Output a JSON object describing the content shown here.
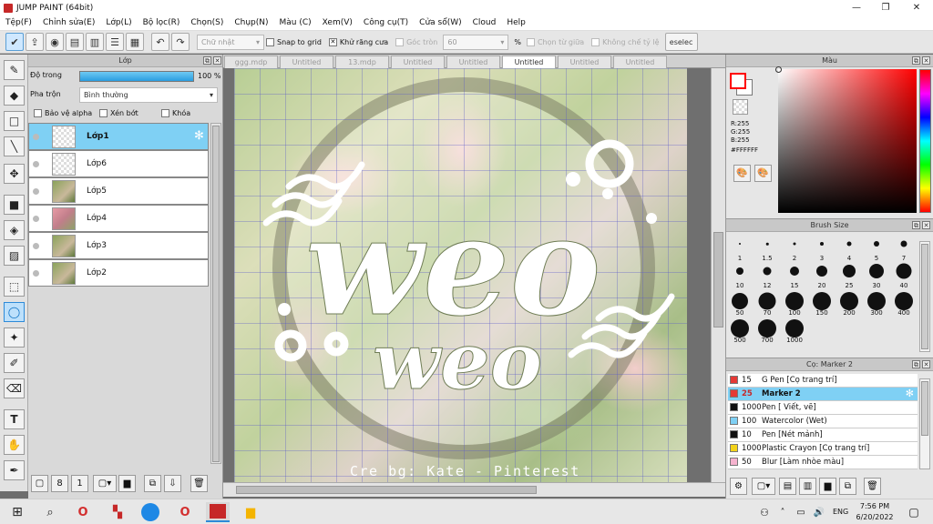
{
  "window": {
    "title": "JUMP PAINT (64bit)",
    "min": "—",
    "max": "❐",
    "close": "✕"
  },
  "menu": [
    "Tệp(F)",
    "Chỉnh sửa(E)",
    "Lớp(L)",
    "Bộ lọc(R)",
    "Chọn(S)",
    "Chụp(N)",
    "Màu (C)",
    "Xem(V)",
    "Công cụ(T)",
    "Cửa sổ(W)",
    "Cloud",
    "Help"
  ],
  "toolbar": {
    "shape_select": "Chữ nhật",
    "snap": "Snap to grid",
    "antialias": "Khử răng cưa",
    "corner": "Góc tròn",
    "corner_value": "60",
    "percent": "%",
    "from_center": "Chọn từ giữa",
    "no_ratio": "Không chế tỷ lệ",
    "deselect": "eselec"
  },
  "layer_panel": {
    "title": "Lớp",
    "opacity_label": "Độ trong",
    "opacity_value": "100 %",
    "opacity": 1.0,
    "blend_label": "Pha trộn",
    "blend_value": "Bình thường",
    "protect_alpha": "Bảo vệ alpha",
    "clip": "Xén bớt",
    "lock": "Khóa",
    "layers": [
      {
        "name": "Lớp1",
        "selected": true
      },
      {
        "name": "Lớp6",
        "selected": false
      },
      {
        "name": "Lớp5",
        "selected": false
      },
      {
        "name": "Lớp4",
        "selected": false
      },
      {
        "name": "Lớp3",
        "selected": false
      },
      {
        "name": "Lớp2",
        "selected": false
      }
    ]
  },
  "tabs": [
    "ggg.mdp",
    "Untitled",
    "13.mdp",
    "Untitled",
    "Untitled",
    "Untitled",
    "Untitled",
    "Untitled"
  ],
  "active_tab": 5,
  "artwork": {
    "line1": "weo",
    "line2": "weo",
    "credit": "Cre bg: Kate - Pinterest"
  },
  "color_panel": {
    "title": "Màu",
    "r": "R:255",
    "g": "G:255",
    "b": "B:255",
    "hex": "#FFFFFF",
    "accent": "#ff0000"
  },
  "brush_panel": {
    "title": "Brush Size",
    "sizes": [
      "1",
      "1.5",
      "2",
      "3",
      "4",
      "5",
      "7",
      "10",
      "12",
      "15",
      "20",
      "25",
      "30",
      "40",
      "50",
      "70",
      "100",
      "150",
      "200",
      "300",
      "400",
      "500",
      "700",
      "1000"
    ]
  },
  "marker_panel": {
    "title": "Cọ: Marker 2",
    "items": [
      {
        "size": "15",
        "name": "G Pen [Cọ trang trí]",
        "color": "#e53935"
      },
      {
        "size": "25",
        "name": "Marker 2",
        "color": "#e53935",
        "selected": true
      },
      {
        "size": "1000",
        "name": "Pen [ Viết, vẽ]",
        "color": "#111111"
      },
      {
        "size": "100",
        "name": "Watercolor (Wet)",
        "color": "#7fd0f4"
      },
      {
        "size": "10",
        "name": "Pen [Nét mảnh]",
        "color": "#111111"
      },
      {
        "size": "1000",
        "name": "Plastic Crayon [Cọ trang trí]",
        "color": "#f2d21a"
      },
      {
        "size": "50",
        "name": "Blur [Làm nhòe màu]",
        "color": "#f6b3cf"
      }
    ]
  },
  "taskbar": {
    "lang": "ENG",
    "time": "7:56 PM",
    "date": "6/20/2022"
  }
}
